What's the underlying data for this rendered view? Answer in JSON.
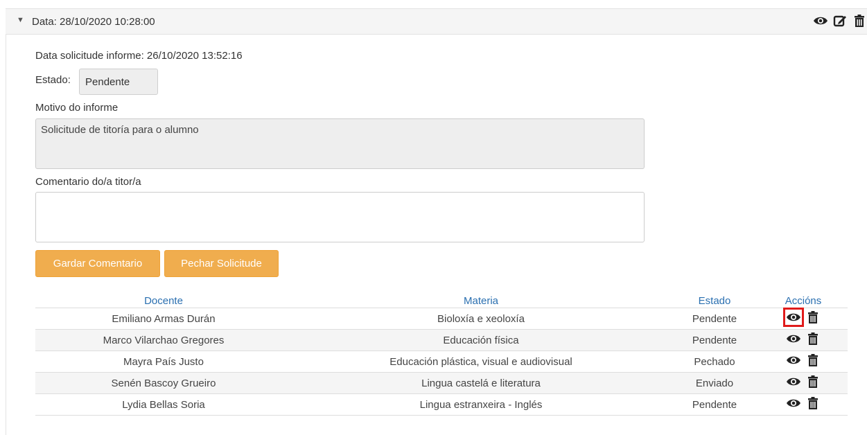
{
  "header": {
    "title": "Data: 28/10/2020 10:28:00"
  },
  "request": {
    "date_line": "Data solicitude informe: 26/10/2020 13:52:16",
    "estado_label": "Estado:",
    "estado_value": "Pendente",
    "motivo_label": "Motivo do informe",
    "motivo_value": "Solicitude de titoría para o alumno",
    "comentario_label": "Comentario do/a titor/a",
    "comentario_value": ""
  },
  "buttons": {
    "save_comment": "Gardar Comentario",
    "close_request": "Pechar Solicitude"
  },
  "table": {
    "headers": [
      "Docente",
      "Materia",
      "Estado",
      "Accións"
    ],
    "rows": [
      {
        "docente": "Emiliano Armas Durán",
        "materia": "Bioloxía e xeoloxía",
        "estado": "Pendente"
      },
      {
        "docente": "Marco Vilarchao Gregores",
        "materia": "Educación física",
        "estado": "Pendente"
      },
      {
        "docente": "Mayra País Justo",
        "materia": "Educación plástica, visual e audiovisual",
        "estado": "Pechado"
      },
      {
        "docente": "Senén Bascoy Grueiro",
        "materia": "Lingua castelá e literatura",
        "estado": "Enviado"
      },
      {
        "docente": "Lydia Bellas Soria",
        "materia": "Lingua estranxeira - Inglés",
        "estado": "Pendente"
      }
    ]
  },
  "colors": {
    "header_link": "#2a6fb0",
    "button": "#f0ad4e",
    "highlight": "#e01b1b"
  },
  "icons": [
    "caret-down-icon",
    "eye-icon",
    "edit-icon",
    "trash-icon"
  ]
}
